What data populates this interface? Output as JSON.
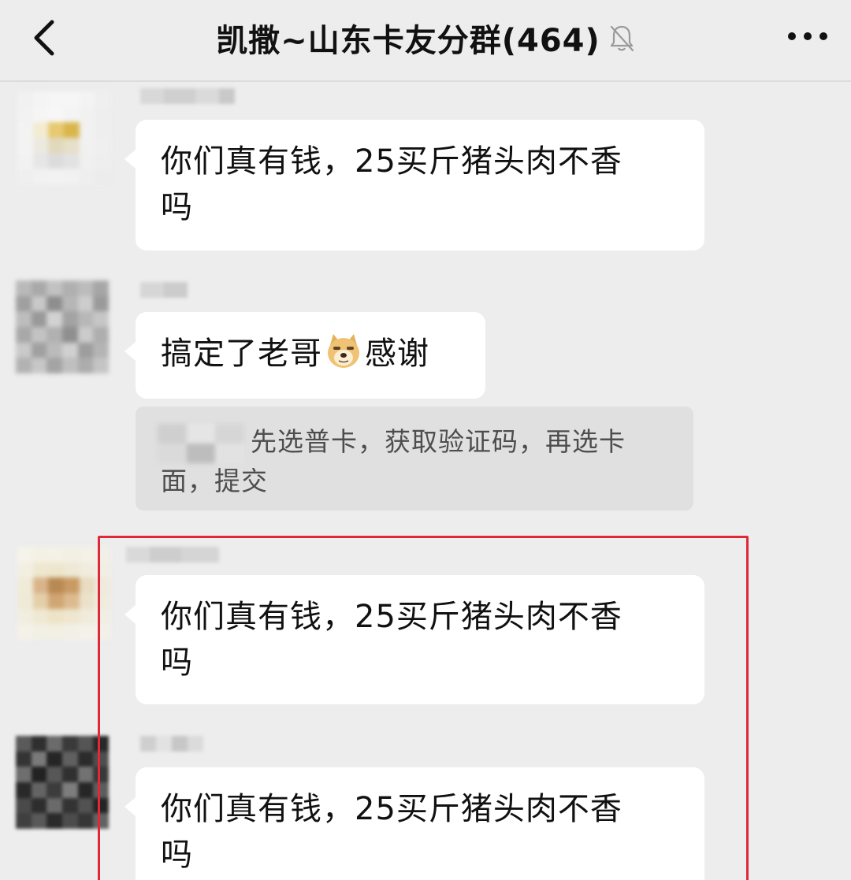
{
  "header": {
    "title": "凯撒~山东卡友分群(464)",
    "icons": {
      "back": "chevron-left-icon",
      "mute": "bell-slash-icon",
      "more": "more-dots-icon"
    }
  },
  "messages": [
    {
      "text_line1": "你们真有钱，25买斤猪头肉不香",
      "text_line2": "吗"
    },
    {
      "text_before_emoji": "搞定了老哥",
      "emoji": "doge-emoji-icon",
      "text_after_emoji": "感谢"
    },
    {
      "text_line1": "你们真有钱，25买斤猪头肉不香",
      "text_line2": "吗"
    },
    {
      "text_line1": "你们真有钱，25买斤猪头肉不香",
      "text_line2": "吗"
    }
  ],
  "quote": {
    "line1": "先选普卡，获取验证码，再选卡",
    "line2": "面，提交"
  },
  "colors": {
    "background": "#ededed",
    "bubble": "#ffffff",
    "quote_background": "#e0e0e0",
    "highlight_border": "#e0283a"
  }
}
